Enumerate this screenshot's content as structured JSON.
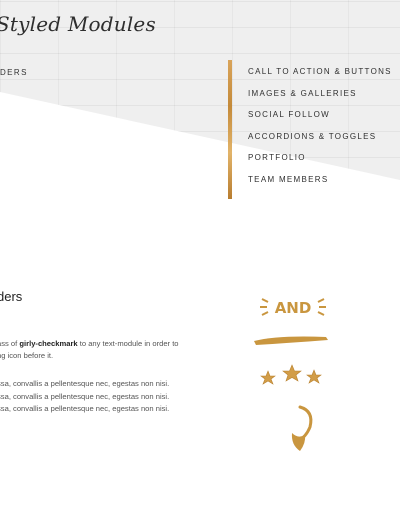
{
  "brand": {
    "title": "Styled Modules"
  },
  "nav_left": {
    "partial_label": "DERS"
  },
  "nav": {
    "items": [
      {
        "label": "CALL TO ACTION & BUTTONS"
      },
      {
        "label": "IMAGES & GALLERIES"
      },
      {
        "label": "SOCIAL FOLLOW"
      },
      {
        "label": "ACCORDIONS & TOGGLES"
      },
      {
        "label": "PORTFOLIO"
      },
      {
        "label": "TEAM MEMBERS"
      }
    ]
  },
  "content": {
    "heading": "ders",
    "desc_pre": "ass of ",
    "desc_strong": "girly-checkmark",
    "desc_post": " to any text-module in order to",
    "desc_line2": "ng icon before it.",
    "lines": [
      "ssa, convallis a pellentesque nec, egestas non nisi.",
      "ssa, convallis a pellentesque nec, egestas non nisi.",
      "ssa, convallis a pellentesque nec, egestas non nisi."
    ]
  },
  "decoration": {
    "and_text": "AND",
    "icons": [
      "sparkle-and-icon",
      "gold-brush-stroke-icon",
      "gold-stars-icon",
      "gold-curly-arrow-icon"
    ],
    "colors": {
      "gold": "#c9963f",
      "gold_light": "#e2b46a"
    }
  }
}
